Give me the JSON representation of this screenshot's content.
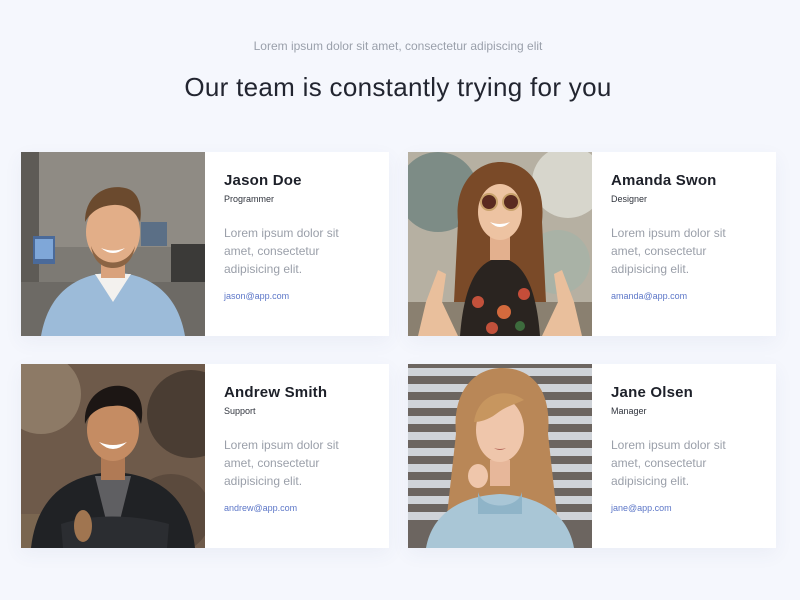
{
  "header": {
    "subtitle": "Lorem ipsum dolor sit amet, consectetur adipiscing elit",
    "title": "Our team is constantly trying for you"
  },
  "members": [
    {
      "name": "Jason Doe",
      "role": "Programmer",
      "description": "Lorem ipsum dolor sit amet, consectetur adipisicing elit.",
      "email": "jason@app.com"
    },
    {
      "name": "Amanda Swon",
      "role": "Designer",
      "description": "Lorem ipsum dolor sit amet, consectetur adipisicing elit.",
      "email": "amanda@app.com"
    },
    {
      "name": "Andrew Smith",
      "role": "Support",
      "description": "Lorem ipsum dolor sit amet, consectetur adipisicing elit.",
      "email": "andrew@app.com"
    },
    {
      "name": "Jane Olsen",
      "role": "Manager",
      "description": "Lorem ipsum dolor sit amet, consectetur adipisicing elit.",
      "email": "jane@app.com"
    }
  ],
  "colors": {
    "background": "#f5f7fd",
    "card": "#ffffff",
    "email_link": "#5d77c8",
    "muted_text": "#9a9fa9"
  }
}
